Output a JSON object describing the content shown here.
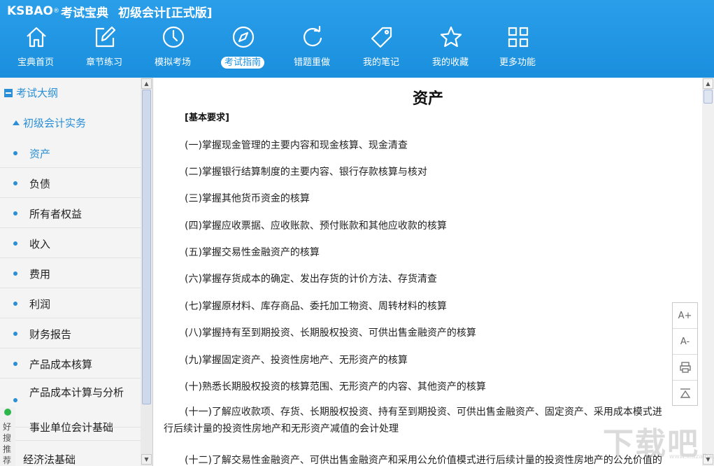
{
  "header": {
    "logo_en": "KSBAO",
    "logo_reg": "®",
    "logo_cn": "考试宝典",
    "app_title": "初级会计[正式版]"
  },
  "nav": [
    {
      "label": "宝典首页",
      "icon": "home-icon"
    },
    {
      "label": "章节练习",
      "icon": "edit-icon"
    },
    {
      "label": "模拟考场",
      "icon": "clock-icon"
    },
    {
      "label": "考试指南",
      "icon": "compass-icon",
      "active": true
    },
    {
      "label": "错题重做",
      "icon": "refresh-icon"
    },
    {
      "label": "我的笔记",
      "icon": "tag-icon"
    },
    {
      "label": "我的收藏",
      "icon": "star-icon"
    },
    {
      "label": "更多功能",
      "icon": "grid-icon"
    }
  ],
  "sidebar": {
    "root": "考试大纲",
    "sub": "初级会计实务",
    "items": [
      {
        "label": "资产",
        "active": true
      },
      {
        "label": "负债"
      },
      {
        "label": "所有者权益"
      },
      {
        "label": "收入"
      },
      {
        "label": "费用"
      },
      {
        "label": "利润"
      },
      {
        "label": "财务报告"
      },
      {
        "label": "产品成本核算"
      },
      {
        "label": "产品成本计算与分析"
      },
      {
        "label": "事业单位会计基础"
      }
    ],
    "next_section": "经济法基础",
    "promo_text": "好搜推荐"
  },
  "content": {
    "title": "资产",
    "requirement_heading": "[基本要求]",
    "lines": [
      "(一)掌握现金管理的主要内容和现金核算、现金清查",
      "(二)掌握银行结算制度的主要内容、银行存款核算与核对",
      "(三)掌握其他货币资金的核算",
      "(四)掌握应收票据、应收账款、预付账款和其他应收款的核算",
      "(五)掌握交易性金融资产的核算",
      "(六)掌握存货成本的确定、发出存货的计价方法、存货清查",
      "(七)掌握原材料、库存商品、委托加工物资、周转材料的核算",
      "(八)掌握持有至到期投资、长期股权投资、可供出售金融资产的核算",
      "(九)掌握固定资产、投资性房地产、无形资产的核算",
      "(十)熟悉长期股权投资的核算范围、无形资产的内容、其他资产的核算"
    ],
    "line11": "(十一)了解应收款项、存货、长期股权投资、持有至到期投资、可供出售金融资产、固定资产、采用成本模式进行后续计量的投资性房地产和无形资产减值的会计处理",
    "line12": "(十二)了解交易性金融资产、可供出售金融资产和采用公允价值模式进行后续计量的投资性房地产的公允价值的"
  },
  "tools": {
    "font_up": "A+",
    "font_down": "A-"
  },
  "watermark": {
    "big": "下载吧",
    "small": "www.xiazaiba.com"
  },
  "colors": {
    "header_blue": "#1a8fdd",
    "accent_blue": "#2a8fd6"
  }
}
